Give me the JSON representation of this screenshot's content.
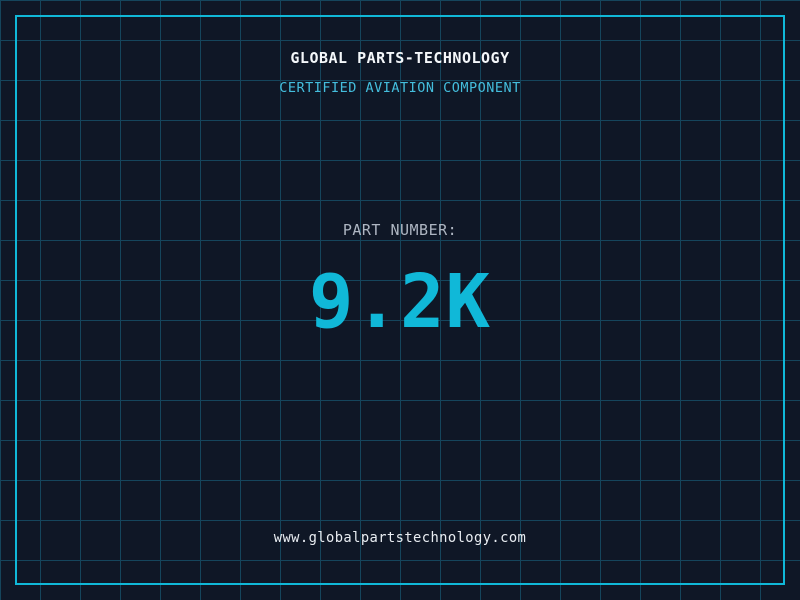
{
  "theme": {
    "background_color": "#0f1726",
    "grid_line_color": "#15455c",
    "accent_color": "#10b8d8",
    "subtitle_color": "#44bedd",
    "label_color": "#aeb6c2",
    "title_color": "#f4f7fa"
  },
  "header": {
    "title": "GLOBAL PARTS-TECHNOLOGY",
    "subtitle": "CERTIFIED AVIATION COMPONENT"
  },
  "part": {
    "label": "PART NUMBER:",
    "value": "9.2K"
  },
  "footer": {
    "website": "www.globalpartstechnology.com"
  }
}
